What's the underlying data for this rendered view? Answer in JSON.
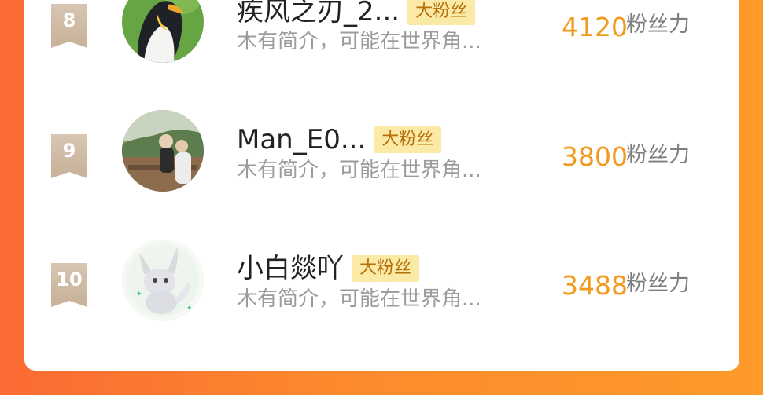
{
  "leaderboard": {
    "entries": [
      {
        "rank": "8",
        "name": "疾风之刃_2...",
        "badge": "大粉丝",
        "bio": "木有简介，可能在世界角...",
        "score": "4120",
        "score_label": "粉丝力",
        "avatar_icon": "penguin-avatar"
      },
      {
        "rank": "9",
        "name": "Man_E0...",
        "badge": "大粉丝",
        "bio": "木有简介，可能在世界角...",
        "score": "3800",
        "score_label": "粉丝力",
        "avatar_icon": "outdoor-photo-avatar"
      },
      {
        "rank": "10",
        "name": "小白燚吖",
        "badge": "大粉丝",
        "bio": "木有简介，可能在世界角...",
        "score": "3488",
        "score_label": "粉丝力",
        "avatar_icon": "fox-cartoon-avatar"
      }
    ]
  },
  "colors": {
    "background_start": "#fb6a33",
    "background_end": "#fd9a2a",
    "score": "#f29a1e",
    "badge_bg": "#fbe9a6",
    "badge_text": "#b56f09",
    "rank_badge": "#c9b39b"
  }
}
